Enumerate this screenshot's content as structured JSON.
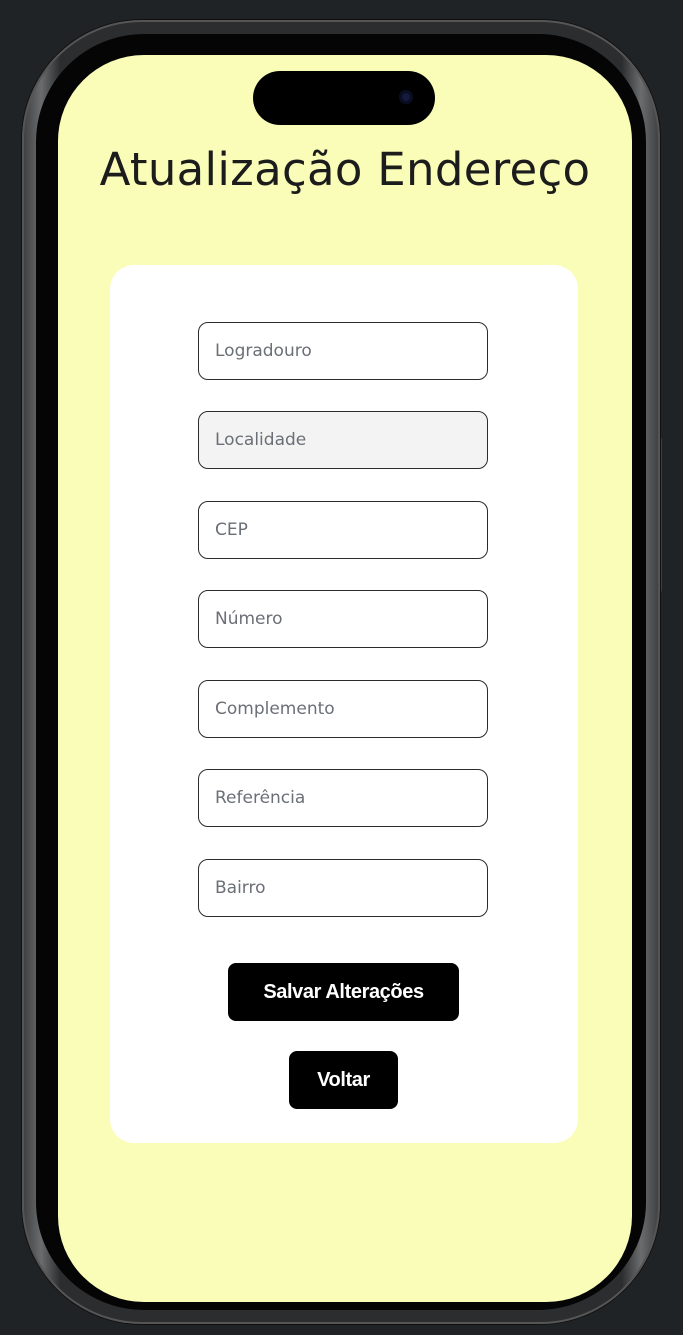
{
  "page": {
    "title": "Atualização Endereço",
    "background_color": "#fafdb8",
    "card_color": "#ffffff",
    "button_color": "#000000"
  },
  "form": {
    "fields": [
      {
        "name": "logradouro",
        "placeholder": "Logradouro",
        "value": "",
        "disabled": false
      },
      {
        "name": "localidade",
        "placeholder": "Localidade",
        "value": "",
        "disabled": true
      },
      {
        "name": "cep",
        "placeholder": "CEP",
        "value": "",
        "disabled": false
      },
      {
        "name": "numero",
        "placeholder": "Número",
        "value": "",
        "disabled": false
      },
      {
        "name": "complemento",
        "placeholder": "Complemento",
        "value": "",
        "disabled": false
      },
      {
        "name": "referencia",
        "placeholder": "Referência",
        "value": "",
        "disabled": false
      },
      {
        "name": "bairro",
        "placeholder": "Bairro",
        "value": "",
        "disabled": false
      }
    ],
    "save_label": "Salvar Alterações",
    "back_label": "Voltar"
  },
  "device": {
    "camera_icon": "camera-lens-icon"
  }
}
